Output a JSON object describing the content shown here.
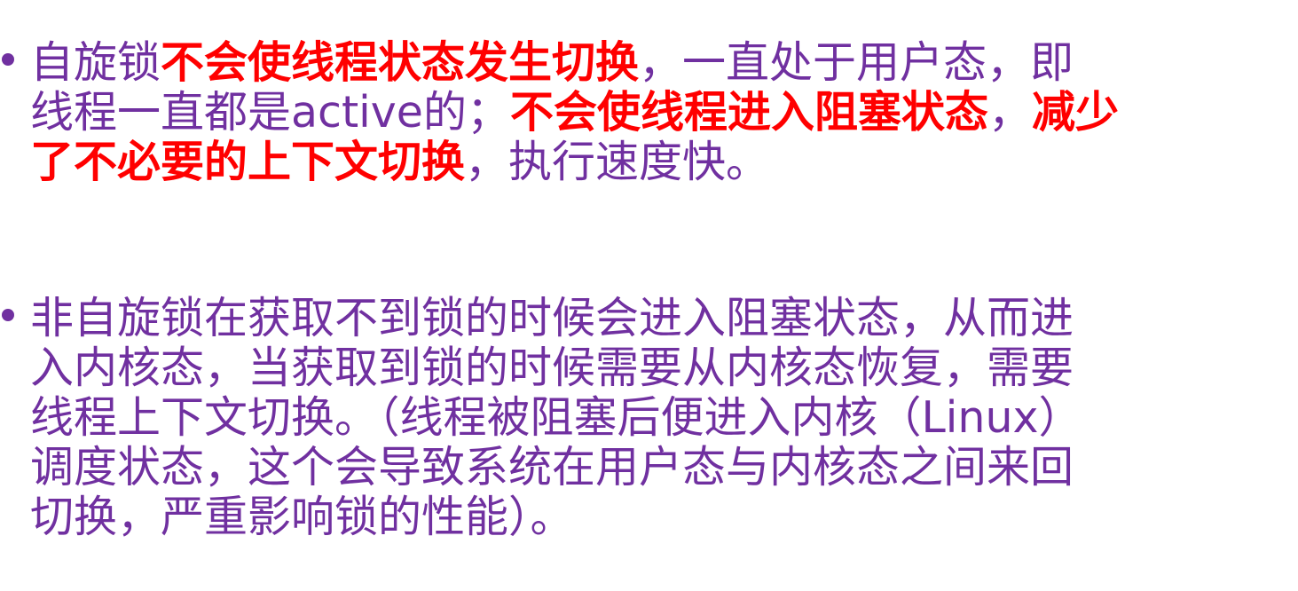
{
  "colors": {
    "text": "#7030a0",
    "highlight": "#ff0000",
    "background": "#ffffff"
  },
  "bullet1": {
    "line1": {
      "a": "自旋锁",
      "b": "不会使线程状态发生切换",
      "c": "，一直处于用户态，即"
    },
    "line2": {
      "a": "线程一直都是active的；",
      "b": "不会使线程进入阻塞状态",
      "c": "，",
      "d": "减少"
    },
    "line3": {
      "a": "了不必要的上下文切换",
      "b": "，执行速度快。"
    }
  },
  "bullet2": {
    "line1": "非自旋锁在获取不到锁的时候会进入阻塞状态，从而进",
    "line2": "入内核态，当获取到锁的时候需要从内核态恢复，需要",
    "line3": "线程上下文切换。（线程被阻塞后便进入内核（Linux）",
    "line4": "调度状态，这个会导致系统在用户态与内核态之间来回",
    "line5": "切换，严重影响锁的性能）。"
  }
}
